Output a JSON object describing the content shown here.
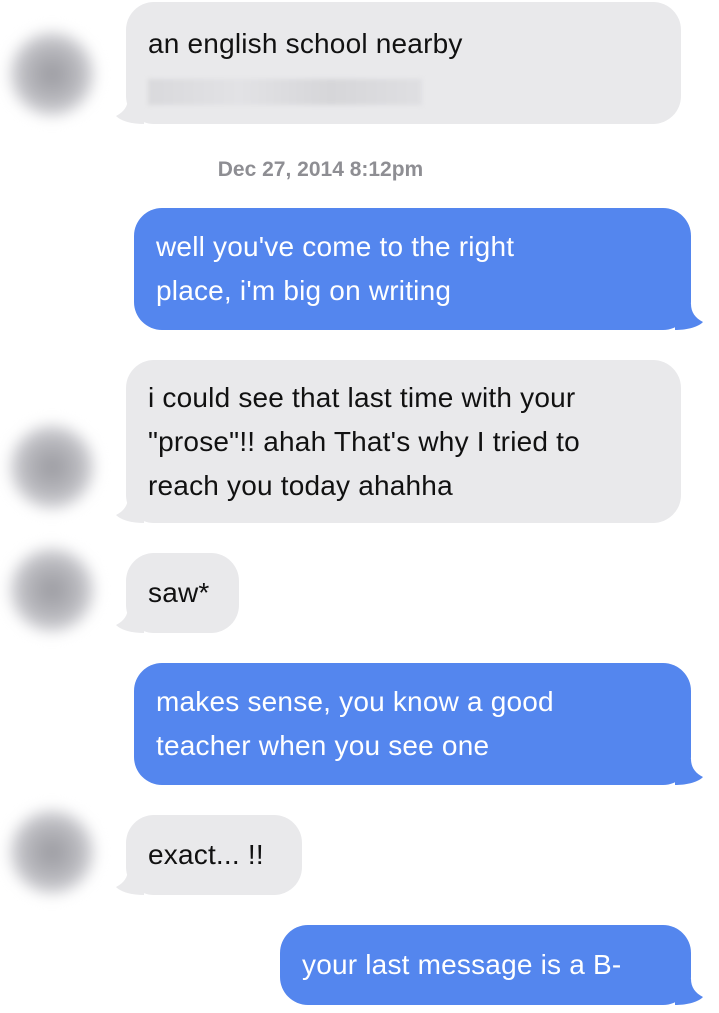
{
  "conversation": {
    "timestamp": "Dec 27, 2014 8:12pm",
    "messages": [
      {
        "direction": "incoming",
        "lines": [
          "an english school nearby"
        ]
      },
      {
        "direction": "outgoing",
        "lines": [
          "well you've come to the right",
          "place, i'm big on writing"
        ]
      },
      {
        "direction": "incoming",
        "lines": [
          "i could see that last time with your",
          "\"prose\"!! ahah That's why I tried to",
          "reach you today ahahha"
        ]
      },
      {
        "direction": "incoming",
        "lines": [
          "saw*"
        ]
      },
      {
        "direction": "outgoing",
        "lines": [
          "makes sense, you know a good",
          "teacher when you see one"
        ]
      },
      {
        "direction": "incoming",
        "lines": [
          "exact... !!"
        ]
      },
      {
        "direction": "outgoing",
        "lines": [
          "your last message is a B-"
        ]
      }
    ]
  },
  "colors": {
    "incoming_bubble": "#e9e9eb",
    "outgoing_bubble": "#5486ee",
    "timestamp_text": "#8e8e93"
  }
}
